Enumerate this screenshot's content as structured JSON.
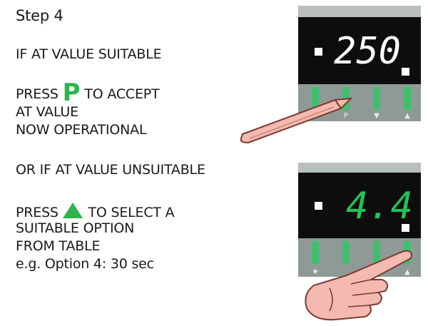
{
  "step_title": "Step 4",
  "if_suitable": "IF AT VALUE SUITABLE",
  "press_accept_before": "PRESS",
  "press_accept_key": "P",
  "press_accept_after": "TO ACCEPT",
  "at_value": "AT VALUE",
  "now_operational": "NOW OPERATIONAL",
  "or_unsuitable": "OR IF AT VALUE UNSUITABLE",
  "press_select_before": "PRESS",
  "press_select_after": "TO SELECT A",
  "suitable_option": "SUITABLE OPTION",
  "from_table": "FROM TABLE",
  "example": "e.g. Option 4: 30 sec",
  "display_top": {
    "readout": "250",
    "key_labels": [
      "",
      "P",
      "▼",
      "▲"
    ]
  },
  "display_bottom": {
    "readout": "4.4",
    "key_labels": [
      "★",
      "",
      "",
      "▲"
    ]
  },
  "colors": {
    "display_bg": "#0d0d0d",
    "readout_top": "#ffffff",
    "readout_bottom": "#22c45a",
    "key_bg": "#8f9a96",
    "key_green": "#3fbf6e",
    "hand": "#f4b9b0",
    "accent": "#2cb44a"
  }
}
